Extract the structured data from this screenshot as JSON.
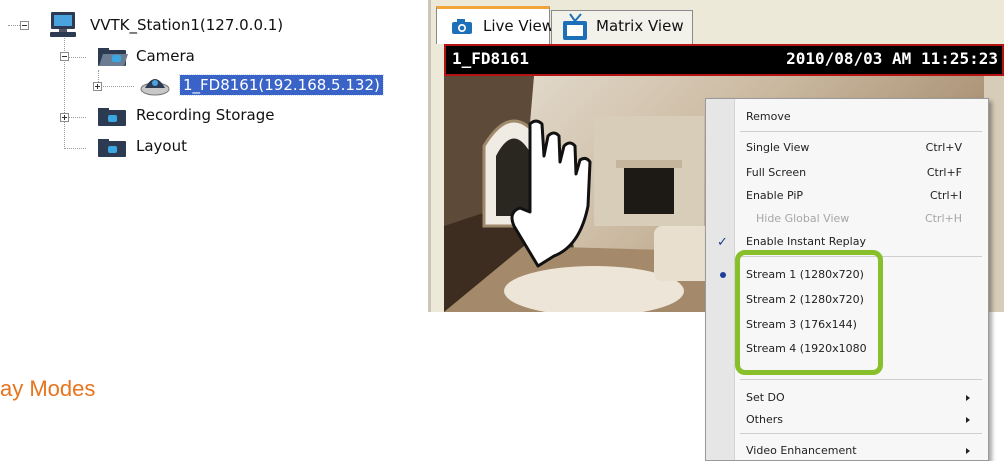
{
  "tree": {
    "station_label": "VVTK_Station1(127.0.0.1)",
    "camera_folder_label": "Camera",
    "camera_item_label": "1_FD8161(192.168.5.132)",
    "recording_storage_label": "Recording Storage",
    "layout_label": "Layout"
  },
  "viewer": {
    "tabs": [
      {
        "label": "Live View",
        "active": true,
        "icon": "camera-icon"
      },
      {
        "label": "Matrix View",
        "active": false,
        "icon": "tv-icon"
      }
    ],
    "camera_name": "1_FD8161",
    "timestamp": "2010/08/03 AM 11:25:23"
  },
  "context_menu": {
    "remove": "Remove",
    "single_view": "Single View",
    "single_view_shortcut": "Ctrl+V",
    "full_screen": "Full Screen",
    "full_screen_shortcut": "Ctrl+F",
    "enable_pip": "Enable PiP",
    "enable_pip_shortcut": "Ctrl+I",
    "hide_global_view": "Hide Global View",
    "hide_global_view_shortcut": "Ctrl+H",
    "enable_instant_replay": "Enable Instant Replay",
    "stream_1": "Stream 1 (1280x720)",
    "stream_2": "Stream 2 (1280x720)",
    "stream_3": "Stream 3 (176x144)",
    "stream_4": "Stream 4 (1920x1080",
    "set_do": "Set DO",
    "others": "Others",
    "video_enhancement": "Video Enhancement"
  },
  "section_heading": "ay Modes",
  "colors": {
    "selection": "#3a63c8",
    "active_tab_accent": "#f2a43a",
    "title_border": "#b21414",
    "stream_highlight": "#87c02a",
    "heading": "#e8741c"
  }
}
